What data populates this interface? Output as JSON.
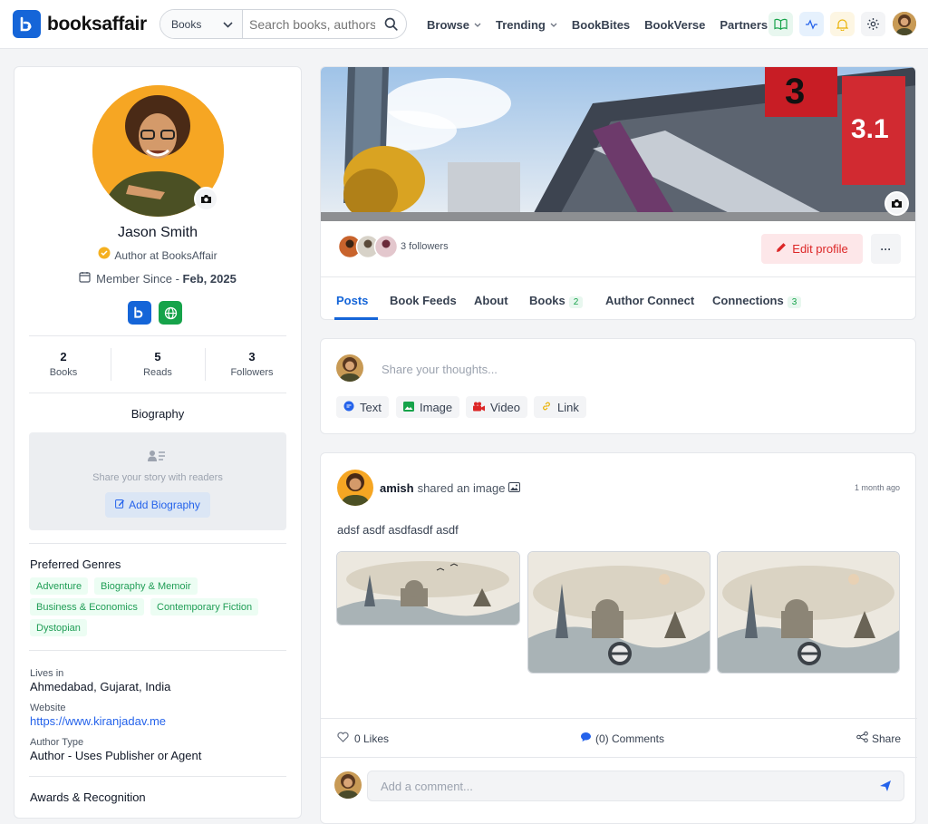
{
  "brand": {
    "name": "booksaffair",
    "color": "#1565d8"
  },
  "search": {
    "category": "Books",
    "placeholder": "Search books, authors"
  },
  "nav": {
    "browse": "Browse",
    "trending": "Trending",
    "bookbites": "BookBites",
    "bookverse": "BookVerse",
    "partners": "Partners"
  },
  "profile": {
    "name": "Jason Smith",
    "role": "Author at BooksAffair",
    "member_since_label": "Member Since - ",
    "member_since_date": "Feb, 2025",
    "stats": [
      {
        "value": "2",
        "label": "Books"
      },
      {
        "value": "5",
        "label": "Reads"
      },
      {
        "value": "3",
        "label": "Followers"
      }
    ],
    "biography_title": "Biography",
    "biography_empty": "Share your story with readers",
    "add_biography": "Add Biography",
    "genres_title": "Preferred Genres",
    "genres": [
      "Adventure",
      "Biography & Memoir",
      "Business & Economics",
      "Contemporary Fiction",
      "Dystopian"
    ],
    "lives_in_label": "Lives in",
    "lives_in": "Ahmedabad, Gujarat, India",
    "website_label": "Website",
    "website": "https://www.kiranjadav.me",
    "author_type_label": "Author Type",
    "author_type": "Author - Uses Publisher or Agent",
    "awards_title": "Awards & Recognition"
  },
  "cover": {
    "followers_text": "3 followers",
    "edit_profile": "Edit profile",
    "more": "···"
  },
  "tabs": [
    {
      "label": "Posts",
      "count": ""
    },
    {
      "label": "Book Feeds",
      "count": ""
    },
    {
      "label": "About",
      "count": ""
    },
    {
      "label": "Books",
      "count": "2"
    },
    {
      "label": "Author Connect",
      "count": ""
    },
    {
      "label": "Connections",
      "count": "3"
    }
  ],
  "composer": {
    "placeholder": "Share your thoughts...",
    "types": [
      "Text",
      "Image",
      "Video",
      "Link"
    ]
  },
  "post": {
    "author": "amish",
    "action": "shared an image",
    "time": "1 month ago",
    "text": "adsf asdf asdfasdf asdf",
    "likes": "0 Likes",
    "comments": "(0) Comments",
    "share": "Share",
    "comment_placeholder": "Add a comment..."
  }
}
